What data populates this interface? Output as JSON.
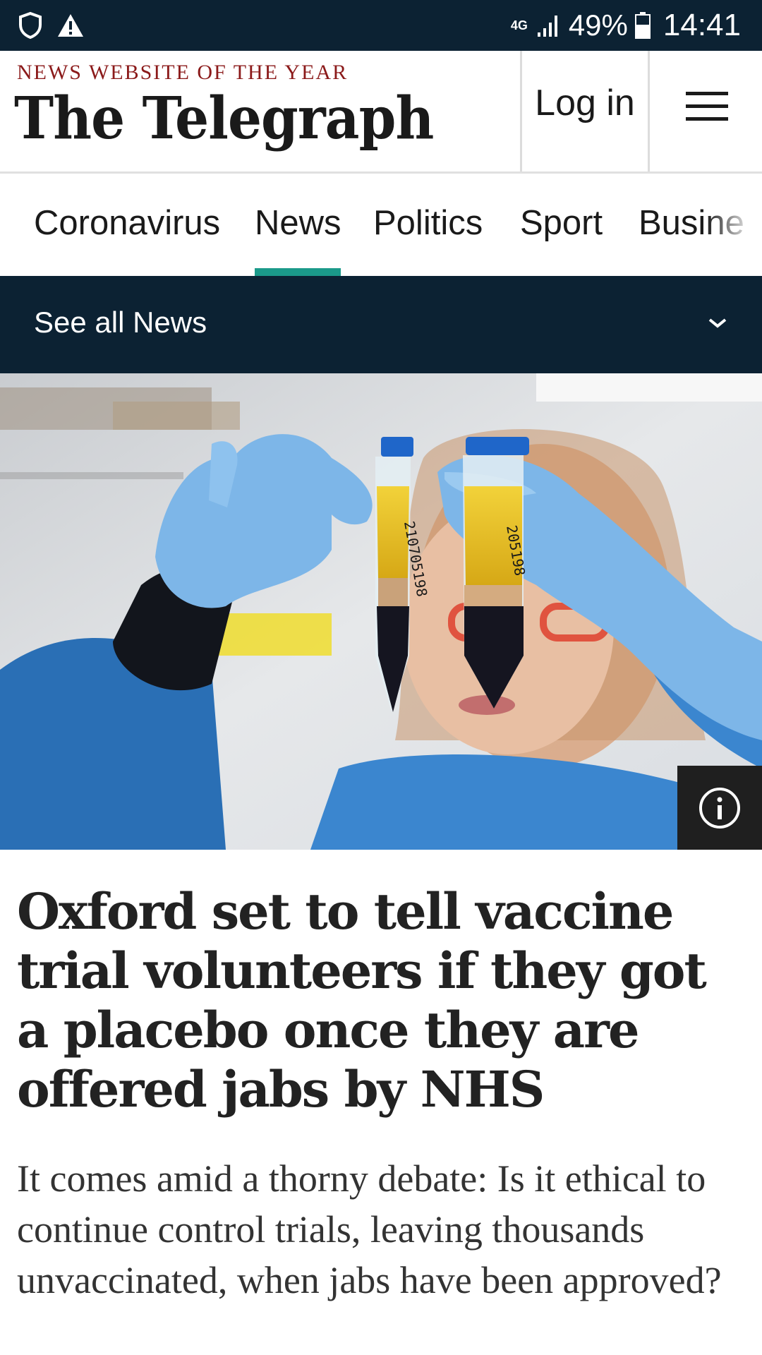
{
  "status_bar": {
    "network": "4G",
    "battery": "49%",
    "time": "14:41",
    "icons": [
      "shield-icon",
      "warning-icon",
      "signal-icon",
      "battery-icon"
    ]
  },
  "header": {
    "tagline": "NEWS WEBSITE OF THE YEAR",
    "logo": "The Telegraph",
    "login_label": "Log in",
    "menu_icon": "hamburger-menu-icon"
  },
  "nav": {
    "items": [
      {
        "label": "Coronavirus"
      },
      {
        "label": "News"
      },
      {
        "label": "Politics"
      },
      {
        "label": "Sport"
      },
      {
        "label": "Busine"
      }
    ],
    "active_index": 1
  },
  "section_bar": {
    "label": "See all News",
    "icon": "chevron-down-icon"
  },
  "hero": {
    "info_icon": "info-icon",
    "tube_labels": [
      "210705198",
      "205198"
    ]
  },
  "article": {
    "headline": "Oxford set to tell vaccine trial volunteers if they got a placebo once they are offered jabs by NHS",
    "standfirst": "It comes amid a thorny debate: Is it ethical to continue control trials, leaving thousands unvaccinated, when jabs have been approved?"
  },
  "colors": {
    "navy": "#0c2233",
    "accent_teal": "#1b9a8a",
    "tagline_red": "#8b1a1a"
  }
}
